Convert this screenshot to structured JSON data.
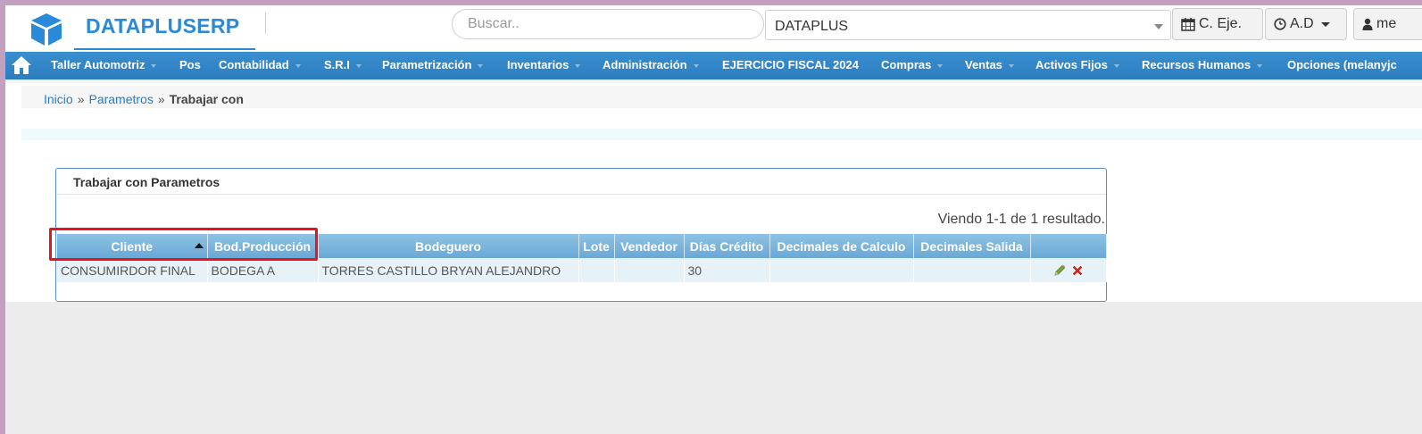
{
  "header": {
    "brand": "DATAPLUSERP",
    "search_placeholder": "Buscar..",
    "company": "DATAPLUS",
    "buttons": {
      "ejercicio_label": "C. Eje.",
      "ad_label": "A.D",
      "user_label": "me"
    }
  },
  "nav": {
    "items": [
      {
        "label": "Taller Automotriz",
        "dropdown": true
      },
      {
        "label": "Pos",
        "dropdown": false
      },
      {
        "label": "Contabilidad",
        "dropdown": true
      },
      {
        "label": "S.R.I",
        "dropdown": true
      },
      {
        "label": "Parametrización",
        "dropdown": true
      },
      {
        "label": "Inventarios",
        "dropdown": true
      },
      {
        "label": "Administración",
        "dropdown": true
      },
      {
        "label": "EJERCICIO FISCAL 2024",
        "dropdown": false
      },
      {
        "label": "Compras",
        "dropdown": true
      },
      {
        "label": "Ventas",
        "dropdown": true
      },
      {
        "label": "Activos Fijos",
        "dropdown": true
      },
      {
        "label": "Recursos Humanos",
        "dropdown": true
      },
      {
        "label": "Opciones (melanyjc",
        "dropdown": false
      }
    ]
  },
  "breadcrumb": {
    "home": "Inicio",
    "separator": "»",
    "section": "Parametros",
    "current": "Trabajar con"
  },
  "panel": {
    "title": "Trabajar con Parametros",
    "summary": "Viendo 1-1 de 1 resultado.",
    "columns": [
      "Cliente",
      "Bod.Producción",
      "Bodeguero",
      "Lote",
      "Vendedor",
      "Días Crédito",
      "Decimales de Calculo",
      "Decimales Salida",
      ""
    ],
    "rows": [
      [
        "CONSUMIRDOR FINAL",
        "BODEGA A",
        "TORRES CASTILLO BRYAN ALEJANDRO",
        "",
        "",
        "30",
        "",
        "",
        ""
      ]
    ],
    "sorted_column": "Cliente",
    "sort_direction": "ascending"
  },
  "colors": {
    "brand": "#2a8ad8",
    "nav_bg": "#2b7dbf",
    "header_cell": "#6aa8d6",
    "highlight": "#e8141c"
  }
}
